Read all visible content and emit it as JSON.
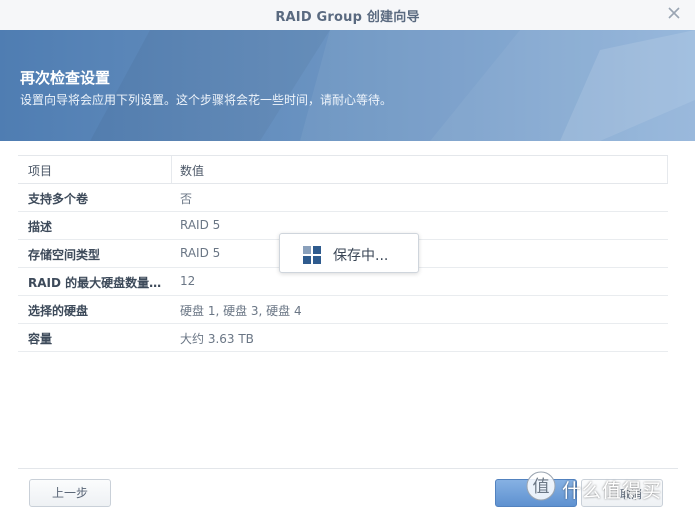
{
  "window": {
    "title": "RAID Group 创建向导"
  },
  "banner": {
    "heading": "再次检查设置",
    "subtitle": "设置向导将会应用下列设置。这个步骤将会花一些时间，请耐心等待。"
  },
  "table": {
    "headers": {
      "key": "项目",
      "value": "数值"
    },
    "rows": [
      {
        "key": "支持多个卷",
        "value": "否"
      },
      {
        "key": "描述",
        "value": "RAID 5"
      },
      {
        "key": "存储空间类型",
        "value": "RAID 5"
      },
      {
        "key": "RAID 的最大硬盘数量…",
        "value": "12"
      },
      {
        "key": "选择的硬盘",
        "value": "硬盘 1, 硬盘 3, 硬盘 4"
      },
      {
        "key": "容量",
        "value": "大约 3.63 TB"
      }
    ]
  },
  "overlay": {
    "saving_text": "保存中..."
  },
  "footer": {
    "prev_label": "上一步",
    "cancel_label": "取消"
  },
  "watermark": {
    "text": "什么值得买"
  },
  "colors": {
    "banner": "#5a86ba",
    "primary_button": "#6a9bd8"
  }
}
